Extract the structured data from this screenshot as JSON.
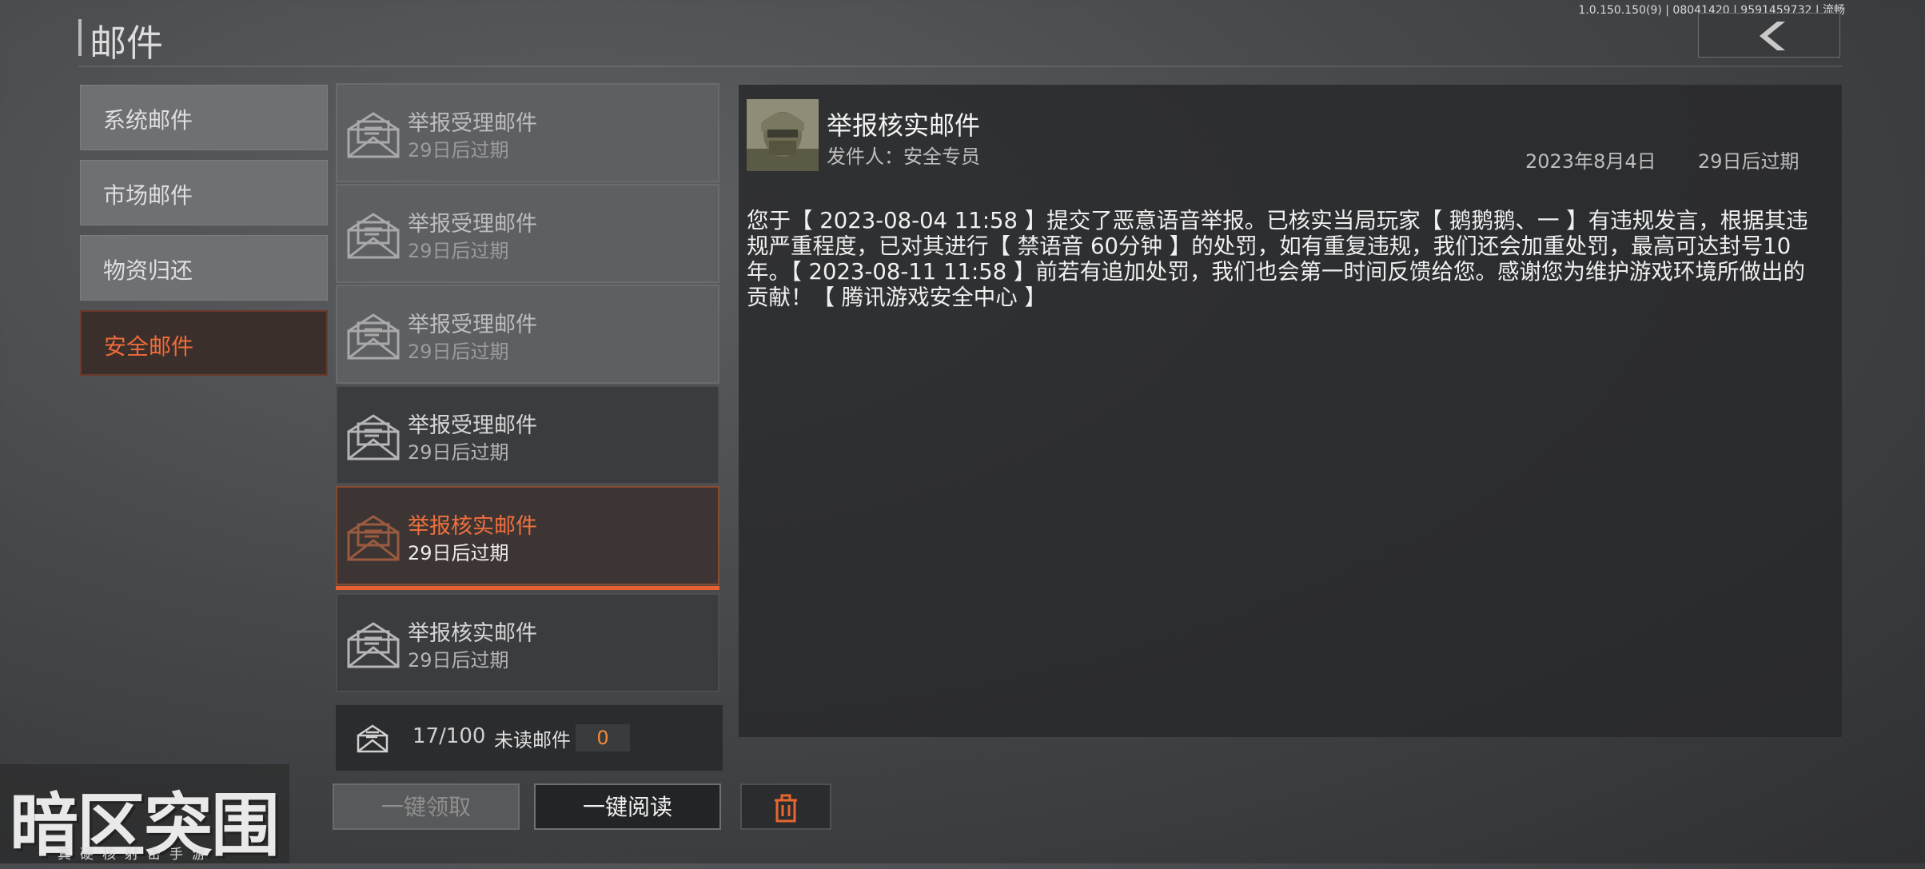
{
  "header": {
    "title": "邮件",
    "version": "1.0.150.150(9) | 08041420 | 9591459732 | 流畅"
  },
  "categories": [
    {
      "label": "系统邮件",
      "active": false
    },
    {
      "label": "市场邮件",
      "active": false
    },
    {
      "label": "物资归还",
      "active": false
    },
    {
      "label": "安全邮件",
      "active": true
    }
  ],
  "mails": [
    {
      "title": "举报受理邮件",
      "expire": "29日后过期",
      "state": "read"
    },
    {
      "title": "举报受理邮件",
      "expire": "29日后过期",
      "state": "read"
    },
    {
      "title": "举报受理邮件",
      "expire": "29日后过期",
      "state": "read"
    },
    {
      "title": "举报受理邮件",
      "expire": "29日后过期",
      "state": "read"
    },
    {
      "title": "举报核实邮件",
      "expire": "29日后过期",
      "state": "selected"
    },
    {
      "title": "举报核实邮件",
      "expire": "29日后过期",
      "state": "unread"
    }
  ],
  "footer": {
    "count": "17/100",
    "unread_label": "未读邮件",
    "unread_count": "0"
  },
  "buttons": {
    "claim_all": "一键领取",
    "read_all": "一键阅读"
  },
  "detail": {
    "subject": "举报核实邮件",
    "sender": "发件人：安全专员",
    "date": "2023年8月4日",
    "expire": "29日后过期",
    "body": "您于【 2023-08-04 11:58 】提交了恶意语音举报。已核实当局玩家【 鹅鹅鹅、一 】有违规发言，根据其违规严重程度，已对其进行【 禁语音 60分钟 】的处罚，如有重复违规，我们还会加重处罚，最高可达封号10年。【 2023-08-11 11:58 】前若有追加处罚，我们也会第一时间反馈给您。感谢您为维护游戏环境所做出的贡献！【 腾讯游戏安全中心 】"
  },
  "logo": {
    "brand": "暗区突围",
    "slogan": "真硬核射击手游"
  },
  "colors": {
    "accent": "#ef6b3a",
    "selected_border": "#8a4a30",
    "unread_count": "#f08a3a"
  },
  "icons": {
    "back": "chevron-left-icon",
    "mail": "envelope-icon",
    "delete": "trash-icon"
  }
}
